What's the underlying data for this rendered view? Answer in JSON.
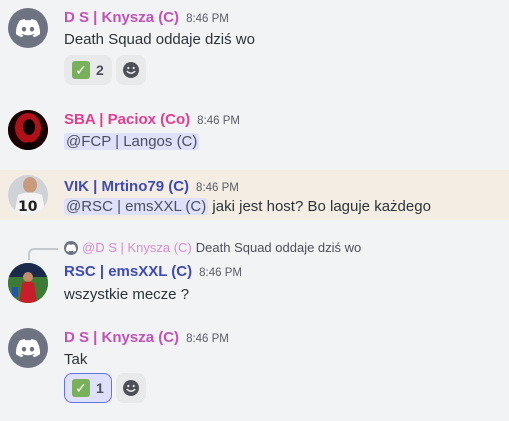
{
  "colors": {
    "ds": "#c451b6",
    "sba": "#e83c8c",
    "vik": "#3f4bb5",
    "rsc": "#3f4bb5",
    "highlight": "#f3ede3",
    "mention_bg": "#dee0fc"
  },
  "messages": [
    {
      "username": "D S | Knysza (C)",
      "time": "8:46 PM",
      "text": "Death Squad oddaje dziś wo",
      "reaction_count": "2"
    },
    {
      "username": "SBA | Paciox (Co)",
      "time": "8:46 PM",
      "mention": "@FCP | Langos (C)"
    },
    {
      "username": "VIK | Mrtino79 (C)",
      "time": "8:46 PM",
      "mention": "@RSC | emsXXL (C)",
      "text": " jaki jest host? Bo laguje każdego"
    },
    {
      "reply_name": "@D S | Knysza (C)",
      "reply_text": "Death Squad oddaje dziś wo",
      "username": "RSC | emsXXL (C)",
      "time": "8:46 PM",
      "text": "wszystkie mecze ?"
    },
    {
      "username": "D S | Knysza (C)",
      "time": "8:46 PM",
      "text": "Tak",
      "reaction_count": "1"
    }
  ],
  "icons": {
    "discord_avatar": "discord-logo-icon",
    "reaction": "check-mark-icon",
    "add_reaction": "smile-icon"
  }
}
